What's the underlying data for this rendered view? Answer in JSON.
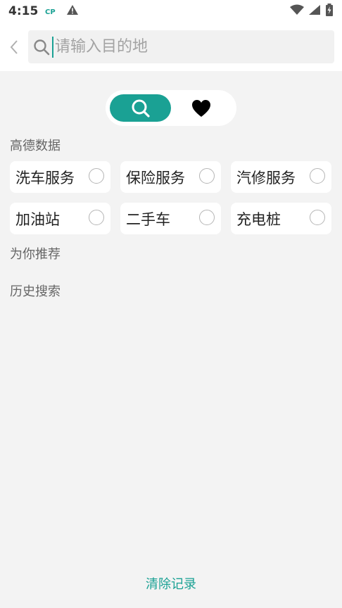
{
  "status": {
    "time": "4:15"
  },
  "search": {
    "placeholder": "请输入目的地",
    "value": ""
  },
  "sections": {
    "amap": "高德数据",
    "recommend": "为你推荐",
    "history": "历史搜索"
  },
  "categories": [
    {
      "label": "洗车服务"
    },
    {
      "label": "保险服务"
    },
    {
      "label": "汽修服务"
    },
    {
      "label": "加油站"
    },
    {
      "label": "二手车"
    },
    {
      "label": "充电桩"
    }
  ],
  "footer": {
    "clear_label": "清除记录"
  },
  "colors": {
    "accent": "#1aa194",
    "background": "#f3f3f3"
  }
}
